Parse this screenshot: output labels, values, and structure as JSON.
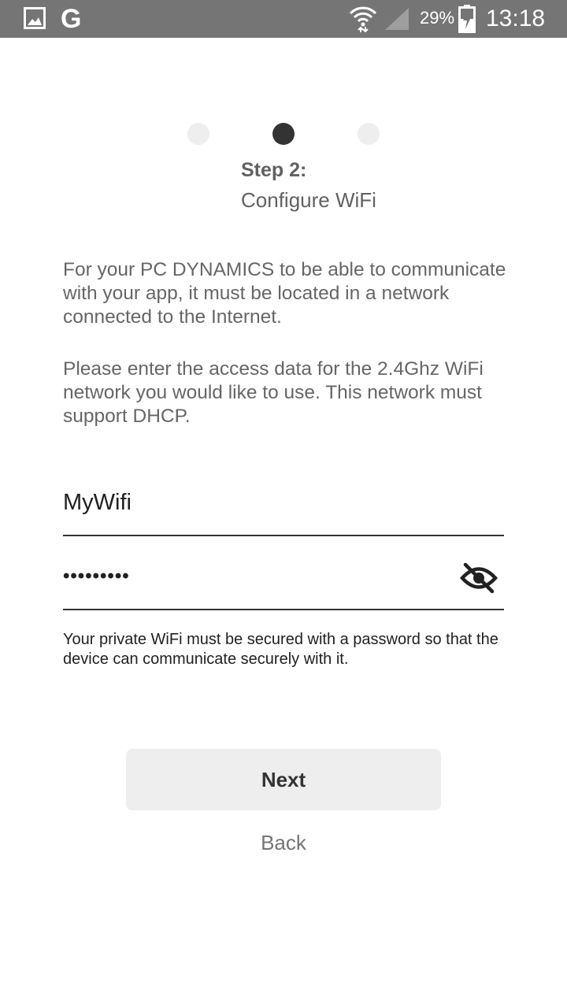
{
  "status_bar": {
    "icons": [
      "gallery-icon",
      "google-icon",
      "wifi-icon",
      "cell-signal-icon",
      "battery-charging-icon"
    ],
    "google_letter": "G",
    "battery_percent": "29%",
    "time": "13:18"
  },
  "stepper": {
    "total": 3,
    "current": 2
  },
  "step": {
    "title": "Step 2:",
    "subtitle": "Configure WiFi"
  },
  "intro": {
    "p1": "For your PC DYNAMICS to be able to communicate with your app, it must be located in a network connected to the Internet.",
    "p2": "Please enter the access data for the 2.4Ghz WiFi network you would like to use. This network must support DHCP."
  },
  "form": {
    "ssid_value": "MyWifi",
    "password_masked": "•••••••••",
    "visibility_icon": "eye-off-icon",
    "hint": "Your private WiFi must be secured with a password so that the device can communicate securely with it."
  },
  "buttons": {
    "next": "Next",
    "back": "Back"
  },
  "colors": {
    "statusbar": "#757575",
    "text": "#666666",
    "active_dot": "#333333",
    "inactive_dot": "#eeeeee",
    "button_bg": "#eeeeee"
  }
}
